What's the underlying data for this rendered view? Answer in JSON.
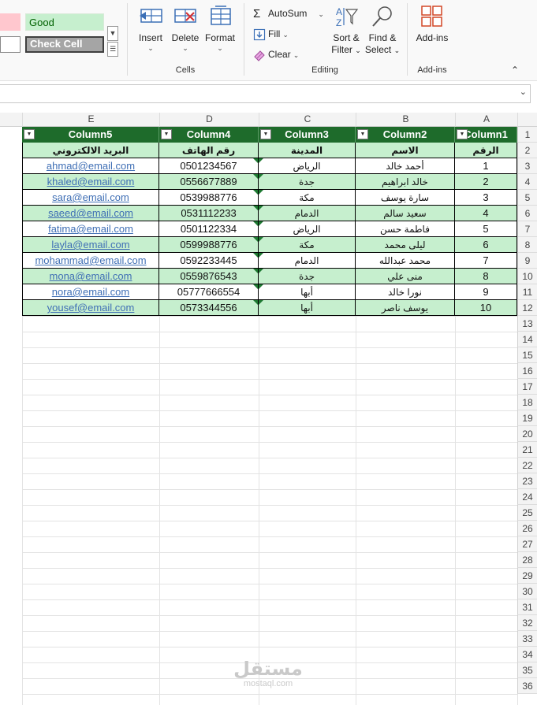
{
  "ribbon": {
    "styles": {
      "good": "Good",
      "check_cell": "Check Cell"
    },
    "cells_group": {
      "label": "Cells",
      "insert": "Insert",
      "delete": "Delete",
      "format": "Format"
    },
    "editing_group": {
      "label": "Editing",
      "autosum": "AutoSum",
      "fill": "Fill",
      "clear": "Clear",
      "sort_filter_line1": "Sort &",
      "sort_filter_line2": "Filter",
      "find_select_line1": "Find &",
      "find_select_line2": "Select"
    },
    "addins_group": {
      "label": "Add-ins",
      "addins": "Add-ins"
    }
  },
  "grid": {
    "column_letters": [
      "E",
      "D",
      "C",
      "B",
      "A"
    ],
    "row_numbers": [
      "1",
      "2",
      "3",
      "4",
      "5",
      "6",
      "7",
      "8",
      "9",
      "10",
      "11",
      "12",
      "13",
      "14",
      "15",
      "16",
      "17",
      "18",
      "19",
      "20",
      "21",
      "22",
      "23",
      "24",
      "25",
      "26",
      "27",
      "28",
      "29",
      "30",
      "31",
      "32",
      "33",
      "34",
      "35",
      "36"
    ],
    "table_headers": [
      "Column5",
      "Column4",
      "Column3",
      "Column2",
      "Column1"
    ],
    "sub_headers": [
      "البريد الالكتروني",
      "رقم الهاتف",
      "المدينة",
      "الاسم",
      "الرقم"
    ],
    "rows": [
      [
        "ahmad@email.com",
        "0501234567",
        "الرياض",
        "أحمد خالد",
        "1"
      ],
      [
        "khaled@email.com",
        "0556677889",
        "جدة",
        "خالد ابراهيم",
        "2"
      ],
      [
        "sara@email.com",
        "0539988776",
        "مكة",
        "سارة يوسف",
        "3"
      ],
      [
        "saeed@email.com",
        "0531112233",
        "الدمام",
        "سعيد سالم",
        "4"
      ],
      [
        "fatima@email.com",
        "0501122334",
        "الرياض",
        "فاطمة حسن",
        "5"
      ],
      [
        "layla@email.com",
        "0599988776",
        "مكة",
        "ليلى محمد",
        "6"
      ],
      [
        "mohammad@email.com",
        "0592233445",
        "الدمام",
        "محمد عبدالله",
        "7"
      ],
      [
        "mona@email.com",
        "0559876543",
        "جدة",
        "منى علي",
        "8"
      ],
      [
        "nora@email.com",
        "05777666554",
        "أبها",
        "نورا خالد",
        "9"
      ],
      [
        "yousef@email.com",
        "0573344556",
        "أبها",
        "يوسف ناصر",
        "10"
      ]
    ]
  },
  "watermark": {
    "arabic": "مستقل",
    "latin": "mostaql.com"
  },
  "colors": {
    "header_green": "#1e6b2b",
    "band_green": "#c6efce",
    "link_blue": "#3f6fb5"
  }
}
